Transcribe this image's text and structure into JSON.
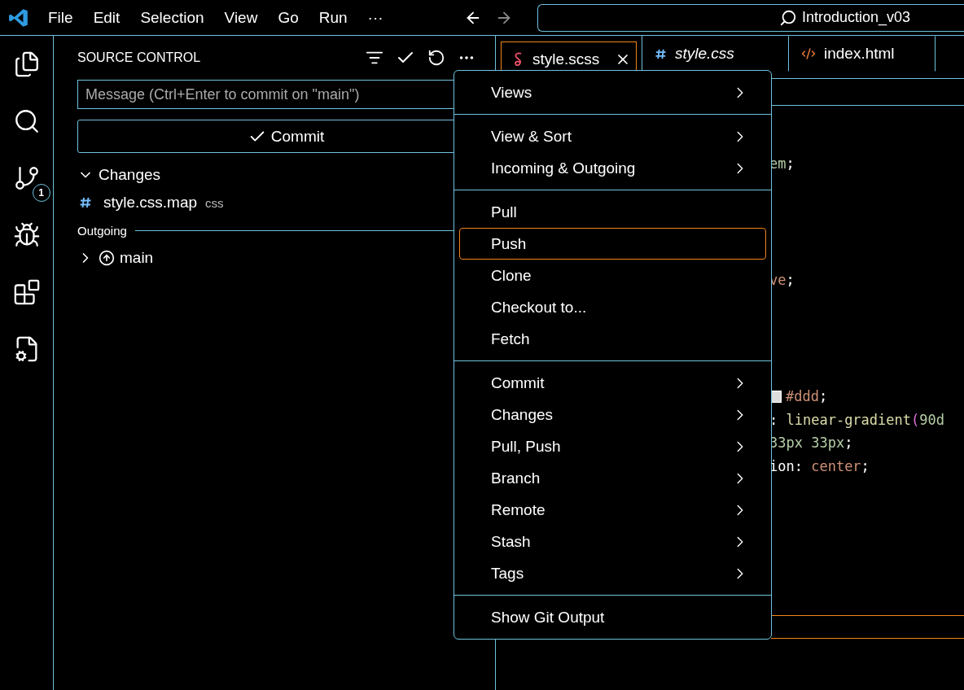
{
  "title_bar": {
    "menus": [
      "File",
      "Edit",
      "Selection",
      "View",
      "Go",
      "Run",
      "···"
    ],
    "back_disabled": false,
    "forward_disabled": true,
    "search": "Introduction_v03"
  },
  "activity_bar": {
    "items": [
      {
        "kind": "files"
      },
      {
        "kind": "search"
      },
      {
        "kind": "scm",
        "badge": "1"
      },
      {
        "kind": "debug"
      },
      {
        "kind": "extensions"
      },
      {
        "kind": "cpp"
      }
    ]
  },
  "sidebar": {
    "title": "SOURCE CONTROL",
    "message_placeholder": "Message (Ctrl+Enter to commit on \"main\")",
    "commit_button": "Commit",
    "changes": {
      "label": "Changes",
      "expanded": true,
      "files": [
        {
          "name": "style.css.map",
          "hint": "css"
        }
      ]
    },
    "outgoing": {
      "label": "Outgoing",
      "branches": [
        {
          "name": "main",
          "expanded": false
        }
      ]
    }
  },
  "tabs": [
    {
      "label": "style.scss",
      "kind": "scss",
      "selected": true,
      "italic": false
    },
    {
      "label": "style.css",
      "kind": "css",
      "selected": false,
      "italic": true
    },
    {
      "label": "index.html",
      "kind": "html",
      "selected": false,
      "italic": false
    }
  ],
  "code": {
    "blocks": [
      [
        [
          {
            "t": "em",
            "kind": "number"
          },
          {
            "t": ";",
            "kind": "plain"
          }
        ]
      ],
      [
        [
          {
            "t": "ve",
            "kind": "string"
          },
          {
            "t": ";",
            "kind": "plain"
          }
        ]
      ],
      [
        [
          {
            "t": "#ddd",
            "kind": "color",
            "swatch": true
          },
          {
            "t": ";",
            "kind": "plain"
          }
        ],
        [
          {
            "t": ": ",
            "kind": "plain"
          },
          {
            "t": "linear-gradient",
            "kind": "function"
          },
          {
            "t": "(",
            "kind": "bracket"
          },
          {
            "t": "90d",
            "kind": "number"
          }
        ],
        [
          {
            "t": "33px 33px",
            "kind": "number"
          },
          {
            "t": ";",
            "kind": "plain"
          }
        ],
        [
          {
            "t": "ion: ",
            "kind": "plain"
          },
          {
            "t": "center",
            "kind": "string"
          },
          {
            "t": ";",
            "kind": "plain"
          }
        ]
      ]
    ]
  },
  "menu": {
    "groups": [
      {
        "items": [
          {
            "label": "Views",
            "submenu": true,
            "selected": false
          }
        ]
      },
      {
        "items": [
          {
            "label": "View & Sort",
            "submenu": true,
            "selected": false
          },
          {
            "label": "Incoming & Outgoing",
            "submenu": true,
            "selected": false
          }
        ]
      },
      {
        "items": [
          {
            "label": "Pull",
            "submenu": false,
            "selected": false
          },
          {
            "label": "Push",
            "submenu": false,
            "selected": true
          },
          {
            "label": "Clone",
            "submenu": false,
            "selected": false
          },
          {
            "label": "Checkout to...",
            "submenu": false,
            "selected": false
          },
          {
            "label": "Fetch",
            "submenu": false,
            "selected": false
          }
        ]
      },
      {
        "items": [
          {
            "label": "Commit",
            "submenu": true,
            "selected": false
          },
          {
            "label": "Changes",
            "submenu": true,
            "selected": false
          },
          {
            "label": "Pull, Push",
            "submenu": true,
            "selected": false
          },
          {
            "label": "Branch",
            "submenu": true,
            "selected": false
          },
          {
            "label": "Remote",
            "submenu": true,
            "selected": false
          },
          {
            "label": "Stash",
            "submenu": true,
            "selected": false
          },
          {
            "label": "Tags",
            "submenu": true,
            "selected": false
          }
        ]
      },
      {
        "items": [
          {
            "label": "Show Git Output",
            "submenu": false,
            "selected": false
          }
        ]
      }
    ]
  }
}
